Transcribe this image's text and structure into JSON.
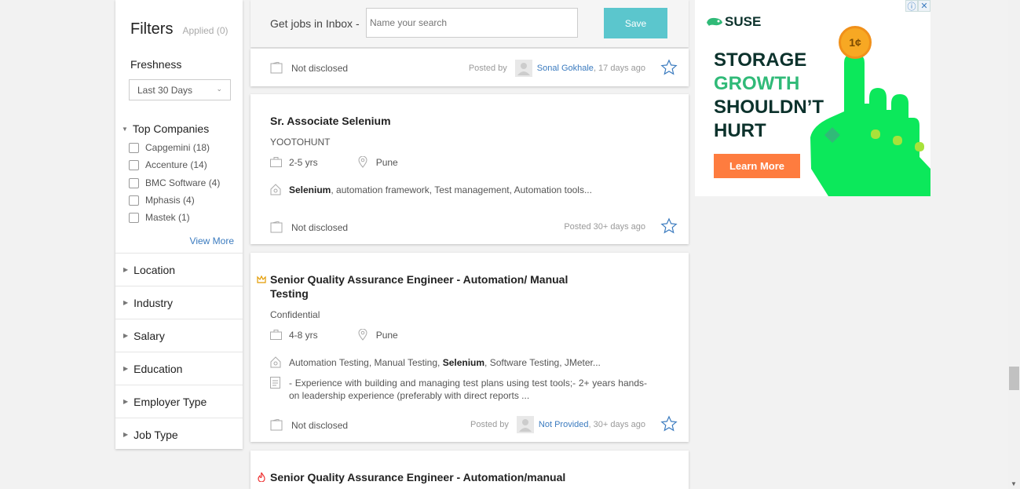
{
  "filters": {
    "title": "Filters",
    "applied": "Applied (0)",
    "freshness_label": "Freshness",
    "freshness_value": "Last 30 Days",
    "top_companies_label": "Top Companies",
    "companies": [
      "Capgemini (18)",
      "Accenture (14)",
      "BMC Software (4)",
      "Mphasis (4)",
      "Mastek (1)"
    ],
    "view_more": "View More",
    "facets": [
      "Location",
      "Industry",
      "Salary",
      "Education",
      "Employer Type",
      "Job Type"
    ]
  },
  "alert": {
    "label": "Get jobs in Inbox -",
    "placeholder": "Name your search",
    "save": "Save"
  },
  "jobs": [
    {
      "salary": "Not disclosed",
      "posted_prefix": "Posted by",
      "poster": "Sonal Gokhale",
      "age": ", 17 days ago"
    },
    {
      "title": "Sr. Associate Selenium",
      "company": "YOOTOHUNT",
      "experience": "2-5 yrs",
      "location": "Pune",
      "skill_bold": "Selenium",
      "skill_rest": ", automation framework, Test management, Automation tools...",
      "salary": "Not disclosed",
      "posted": "Posted  30+ days ago"
    },
    {
      "title_line1": "Senior Quality Assurance Engineer - Automation/ Manual",
      "title_line2": "Testing",
      "company": "Confidential",
      "experience": "4-8 yrs",
      "location": "Pune",
      "skill_pre": "Automation Testing, Manual Testing, ",
      "skill_bold": "Selenium",
      "skill_rest": ", Software Testing, JMeter...",
      "description": "- Experience with building and managing test plans using test tools;- 2+ years hands-on leadership experience (preferably with direct reports ...",
      "salary": "Not disclosed",
      "posted_prefix": "Posted by",
      "poster": "Not Provided",
      "age": ", 30+ days ago"
    },
    {
      "title": "Senior Quality Assurance Engineer - Automation/manual"
    }
  ],
  "ad": {
    "brand": "SUSE",
    "line1": "STORAGE",
    "line2": "GROWTH",
    "line3": "SHOULDN’T",
    "line4": "HURT",
    "button": "Learn More",
    "coin": "1¢",
    "info": "ⓘ",
    "close": "✕",
    "colors": {
      "green": "#30ba78",
      "bright_green": "#0ce85b",
      "orange": "#fe7c3f",
      "navy": "#0c322c"
    }
  },
  "colors": {
    "link": "#3b7bbf",
    "save_button": "#5bc6cd",
    "star": "#3b7bbf"
  }
}
